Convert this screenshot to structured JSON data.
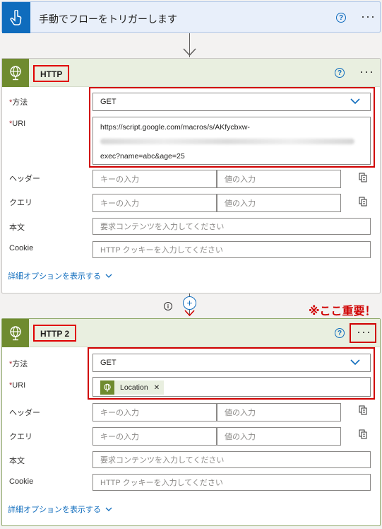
{
  "trigger": {
    "title": "手動でフローをトリガーします",
    "help": "?",
    "more": "···"
  },
  "http1": {
    "name": "HTTP",
    "help": "?",
    "more": "···",
    "method_label": "方法",
    "method_value": "GET",
    "uri_label": "URI",
    "uri_line1": "https://script.google.com/macros/s/AKfycbxw-",
    "uri_line3": "exec?name=abc&age=25",
    "headers_label": "ヘッダー",
    "key_placeholder": "キーの入力",
    "value_placeholder": "値の入力",
    "query_label": "クエリ",
    "body_label": "本文",
    "body_placeholder": "要求コンテンツを入力してください",
    "cookie_label": "Cookie",
    "cookie_placeholder": "HTTP クッキーを入力してください",
    "advanced_link": "詳細オプションを表示する"
  },
  "note": "※ここ重要！",
  "http2": {
    "name": "HTTP 2",
    "help": "?",
    "more": "···",
    "method_label": "方法",
    "method_value": "GET",
    "uri_label": "URI",
    "uri_token": "Location",
    "headers_label": "ヘッダー",
    "key_placeholder": "キーの入力",
    "value_placeholder": "値の入力",
    "query_label": "クエリ",
    "body_label": "本文",
    "body_placeholder": "要求コンテンツを入力してください",
    "cookie_label": "Cookie",
    "cookie_placeholder": "HTTP クッキーを入力してください",
    "advanced_link": "詳細オプションを表示する"
  },
  "colors": {
    "accent": "#0f6cbd",
    "http_icon": "#6f8b2f",
    "highlight": "#d00000",
    "required": "#a4262c"
  }
}
